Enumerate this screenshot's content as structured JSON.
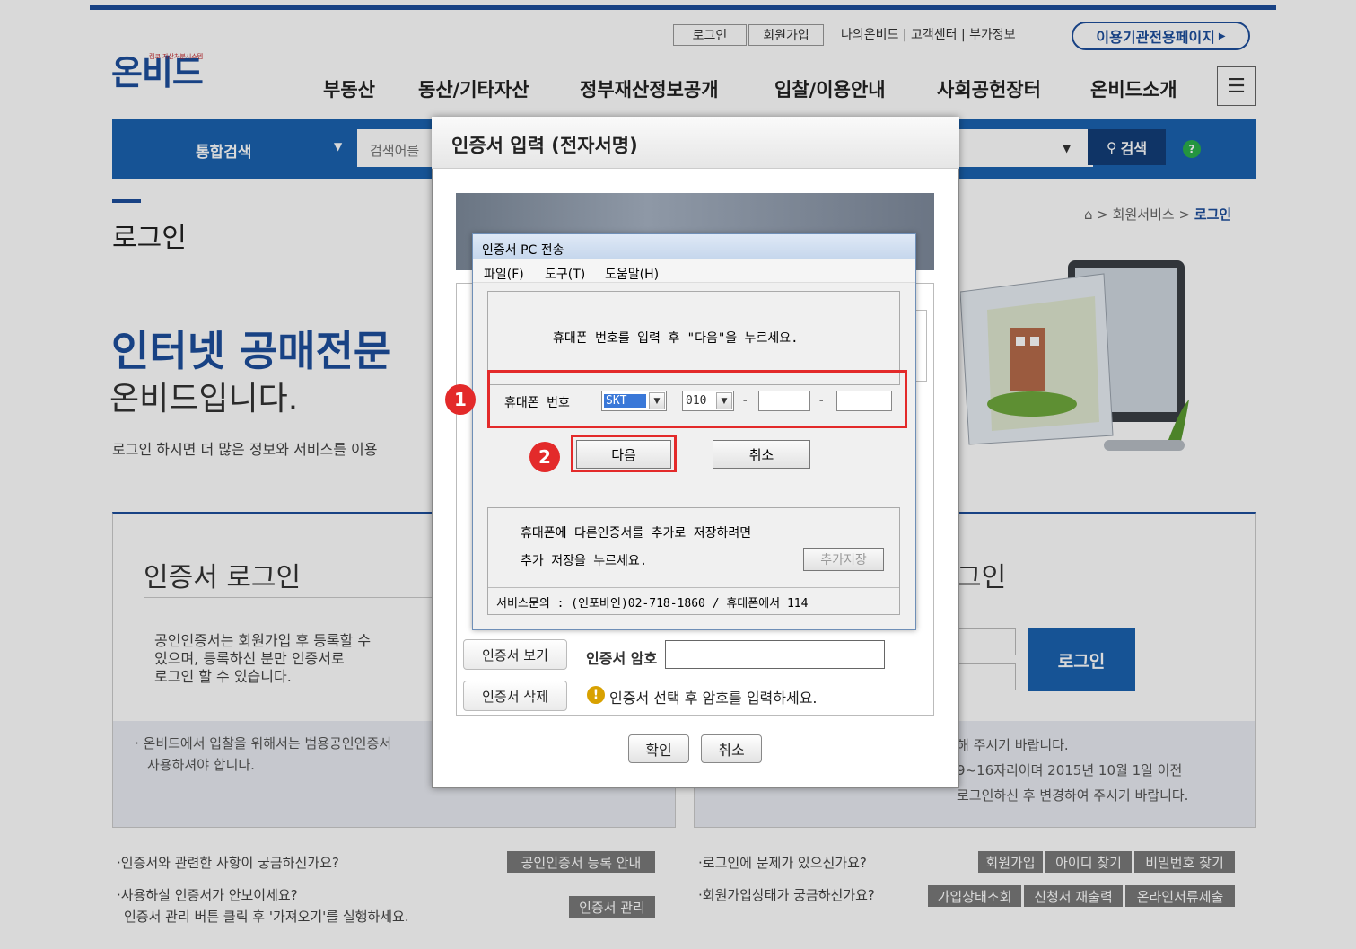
{
  "header": {
    "login": "로그인",
    "signup": "회원가입",
    "util_links": "나의온비드 | 고객센터 | 부가정보",
    "org_page": "이용기관전용페이지",
    "logo": "온비드",
    "logo_sub": "캠코 자산처분시스템",
    "nav": [
      "부동산",
      "동산/기타자산",
      "정부재산정보공개",
      "입찰/이용안내",
      "사회공헌장터",
      "온비드소개"
    ],
    "menu_icon": "hamburger-icon"
  },
  "search": {
    "category": "통합검색",
    "placeholder": "검색어를",
    "button": "검색"
  },
  "breadcrumb": {
    "home": "home-icon",
    "sep1": ">",
    "service": "회원서비스",
    "sep2": ">",
    "current": "로그인"
  },
  "page_title": "로그인",
  "hero": {
    "line1": "인터넷 공매전문",
    "line2": "온비드입니다.",
    "line3": "로그인 하시면 더 많은 정보와 서비스를 이용"
  },
  "cert_panel": {
    "title": "인증서 로그인",
    "desc1": "공인인증서는 회원가입 후 등록할 수",
    "desc2": "있으며, 등록하신 분만 인증서로",
    "desc3": "로그인 할 수 있습니다.",
    "note1": "· 온비드에서 입찰을 위해서는 범용공인인증서",
    "note2": "사용하셔야 합니다."
  },
  "id_panel": {
    "title": "그인",
    "login_button": "로그인",
    "note1": "해 주시기 바랍니다.",
    "note2": "9~16자리이며 2015년 10월 1일 이전",
    "note3": "로그인하신 후 변경하여 주시기 바랍니다."
  },
  "bottom": {
    "q1": "·인증서와 관련한 사항이 궁금하신가요?",
    "b1": "공인인증서 등록 안내",
    "q2": "·사용하실 인증서가 안보이세요?",
    "q2b": "인증서 관리 버튼 클릭 후 '가져오기'를 실행하세요.",
    "b2": "인증서 관리",
    "q3": "·로그인에 문제가 있으신가요?",
    "b3": [
      "회원가입",
      "아이디 찾기",
      "비밀번호 찾기"
    ],
    "q4": "·회원가입상태가 궁금하신가요?",
    "b4": [
      "가입상태조회",
      "신청서 재출력",
      "온라인서류제출"
    ]
  },
  "cert_dialog": {
    "title": "인증서 입력 (전자서명)",
    "view_cert": "인증서 보기",
    "delete_cert": "인증서 삭제",
    "pw_label": "인증서 암호",
    "warning": "인증서 선택 후 암호를 입력하세요.",
    "ok": "확인",
    "cancel": "취소"
  },
  "pc_window": {
    "title": "인증서 PC 전송",
    "menu": [
      "파일(F)",
      "도구(T)",
      "도움말(H)"
    ],
    "instruction": "휴대폰 번호를 입력 후 \"다음\"을 누르세요.",
    "phone_label": "휴대폰 번호",
    "carrier": "SKT",
    "prefix": "010",
    "dash": "-",
    "next": "다음",
    "cancel": "취소",
    "extra1": "휴대폰에 다른인증서를 추가로 저장하려면",
    "extra2": "추가 저장을 누르세요.",
    "extra_button": "추가저장",
    "service": "서비스문의 : (인포바인)02-718-1860 / 휴대폰에서 114"
  },
  "markers": [
    "1",
    "2"
  ],
  "colors": {
    "brand": "#1d4e9c",
    "search_bar": "#1b62b0",
    "highlight": "#e32a2a"
  }
}
